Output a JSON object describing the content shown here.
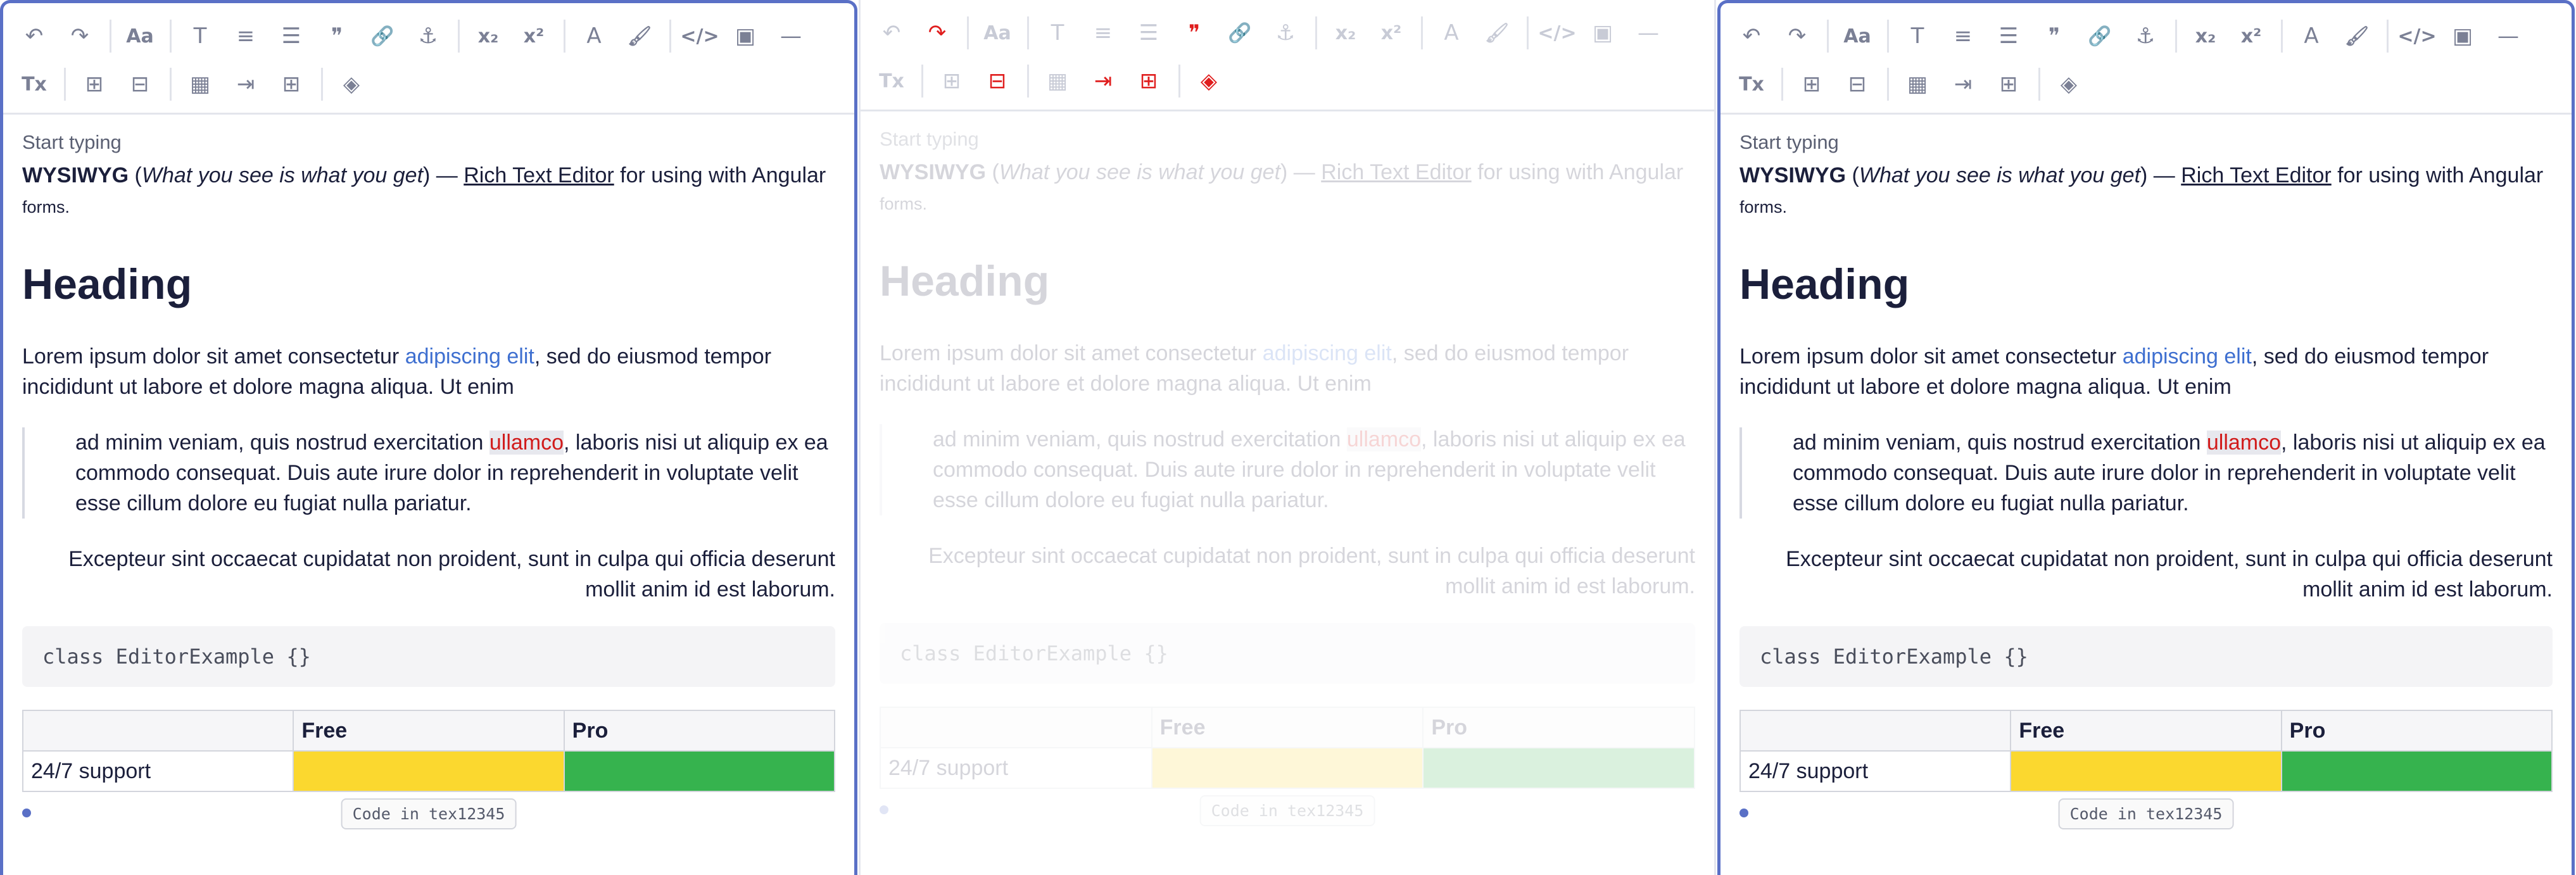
{
  "toolbar": {
    "row1": [
      {
        "name": "undo-icon",
        "glyph": "↶"
      },
      {
        "name": "redo-icon",
        "glyph": "↷"
      },
      {
        "sep": true
      },
      {
        "name": "font-size-icon",
        "glyph": "Aa"
      },
      {
        "sep": true
      },
      {
        "name": "font-style-icon",
        "glyph": "T"
      },
      {
        "name": "align-icon",
        "glyph": "≡"
      },
      {
        "name": "list-icon",
        "glyph": "☰"
      },
      {
        "name": "quote-icon",
        "glyph": "❞"
      },
      {
        "name": "link-icon",
        "glyph": "🔗"
      },
      {
        "name": "anchor-icon",
        "glyph": "⚓"
      },
      {
        "sep": true
      },
      {
        "name": "subscript-icon",
        "glyph": "x₂"
      },
      {
        "name": "superscript-icon",
        "glyph": "x²"
      },
      {
        "sep": true
      },
      {
        "name": "text-color-icon",
        "glyph": "A"
      },
      {
        "name": "format-painter-icon",
        "glyph": "🖌"
      },
      {
        "sep": true
      },
      {
        "name": "code-icon",
        "glyph": "</>"
      },
      {
        "name": "image-icon",
        "glyph": "▣"
      },
      {
        "name": "horizontal-rule-icon",
        "glyph": "—"
      }
    ],
    "row2": [
      {
        "name": "clear-format-icon",
        "glyph": "Tx"
      },
      {
        "sep": true
      },
      {
        "name": "insert-above-icon",
        "glyph": "⊞"
      },
      {
        "name": "remove-icon",
        "glyph": "⊟"
      },
      {
        "sep": true
      },
      {
        "name": "table-icon",
        "glyph": "▦"
      },
      {
        "name": "insert-column-icon",
        "glyph": "⇥"
      },
      {
        "name": "merge-cells-icon",
        "glyph": "⊞"
      },
      {
        "sep": true
      },
      {
        "name": "cell-fill-icon",
        "glyph": "◈"
      }
    ]
  },
  "editor": {
    "placeholder": "Start typing",
    "intro": {
      "bold": "WYSIWYG",
      "paren_open": " (",
      "italic": "What you see is what you get",
      "paren_close": ") — ",
      "underline": "Rich Text Editor",
      "rest": " for using with Angular ",
      "small": "forms."
    },
    "heading": "Heading",
    "para": {
      "before": "Lorem ipsum dolor sit amet consectetur ",
      "link": "adipiscing elit",
      "after": ", sed do eiusmod tempor incididunt ut labore et dolore magna aliqua. Ut enim"
    },
    "quote": {
      "before": "ad minim veniam, quis nostrud exercitation ",
      "mark": "ullamco",
      "after": ", laboris nisi ut aliquip ex ea commodo consequat. Duis aute irure dolor in reprehenderit in voluptate velit esse cillum dolore eu fugiat nulla pariatur."
    },
    "right_para": "Excepteur sint occaecat cupidatat non proident, sunt in culpa qui officia deserunt mollit anim id est laborum.",
    "code": "class EditorExample {}",
    "table": {
      "headers": [
        "",
        "Free",
        "Pro"
      ],
      "row": [
        "24/7 support",
        "",
        ""
      ]
    },
    "footer_badge": "Code in tex12345"
  },
  "colors": {
    "focus_border": "#5a70c6",
    "link": "#3e6fd0",
    "mark_text": "#d11b1b",
    "free_cell": "#fbd82f",
    "pro_cell": "#36b34e",
    "active_tool": "#e01e1e"
  },
  "panels": [
    {
      "state": "focused"
    },
    {
      "state": "disabled",
      "active_tools": [
        "redo-icon",
        "quote-icon",
        "remove-icon",
        "insert-column-icon",
        "merge-cells-icon",
        "cell-fill-icon"
      ]
    },
    {
      "state": "focused"
    }
  ]
}
